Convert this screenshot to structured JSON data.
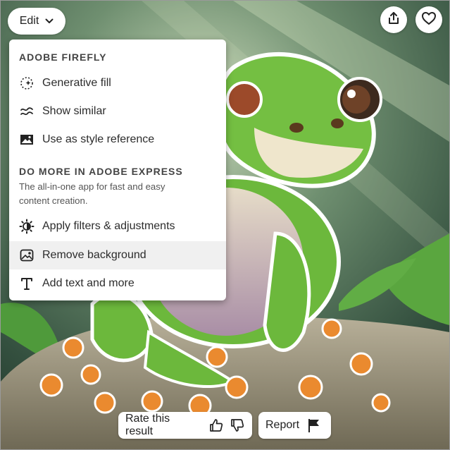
{
  "toolbar": {
    "edit_label": "Edit",
    "share_icon": "share-icon",
    "favorite_icon": "heart-icon"
  },
  "menu": {
    "section1_title": "ADOBE FIREFLY",
    "items1": [
      {
        "label": "Generative fill",
        "icon": "generative-fill-icon"
      },
      {
        "label": "Show similar",
        "icon": "approx-icon"
      },
      {
        "label": "Use as style reference",
        "icon": "image-icon"
      }
    ],
    "section2_title": "DO MORE IN ADOBE EXPRESS",
    "section2_desc": "The all-in-one app for fast and easy content creation.",
    "items2": [
      {
        "label": "Apply filters & adjustments",
        "icon": "brightness-icon"
      },
      {
        "label": "Remove background",
        "icon": "remove-background-icon"
      },
      {
        "label": "Add text and more",
        "icon": "text-icon"
      }
    ]
  },
  "feedback": {
    "rate_label": "Rate this result",
    "report_label": "Report"
  },
  "colors": {
    "accent_green": "#6dbb3c",
    "menu_bg": "#ffffff",
    "hover_bg": "#f0f0f0"
  }
}
